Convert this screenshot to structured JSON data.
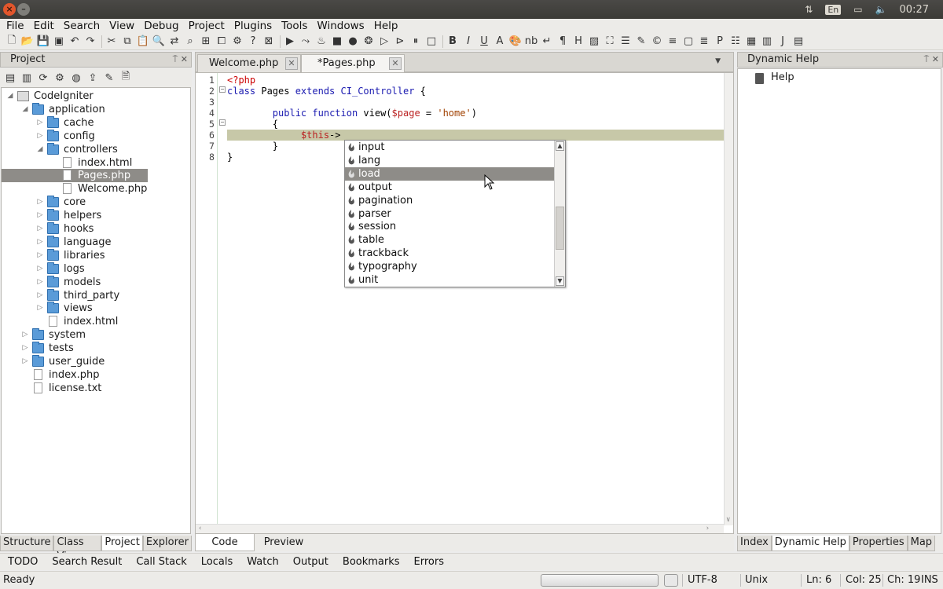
{
  "tray": {
    "language": "En",
    "clock": "00:27"
  },
  "menu": [
    "File",
    "Edit",
    "Search",
    "View",
    "Debug",
    "Project",
    "Plugins",
    "Tools",
    "Windows",
    "Help"
  ],
  "project_panel": {
    "title": "Project",
    "tree": [
      {
        "label": "CodeIgniter",
        "type": "root",
        "depth": 0,
        "arrow": "open"
      },
      {
        "label": "application",
        "type": "folder",
        "depth": 1,
        "arrow": "open"
      },
      {
        "label": "cache",
        "type": "folder",
        "depth": 2,
        "arrow": "closed"
      },
      {
        "label": "config",
        "type": "folder",
        "depth": 2,
        "arrow": "closed"
      },
      {
        "label": "controllers",
        "type": "folder",
        "depth": 2,
        "arrow": "open"
      },
      {
        "label": "index.html",
        "type": "file",
        "depth": 3,
        "arrow": "none"
      },
      {
        "label": "Pages.php",
        "type": "file",
        "depth": 3,
        "arrow": "none",
        "selected": true
      },
      {
        "label": "Welcome.php",
        "type": "file",
        "depth": 3,
        "arrow": "none"
      },
      {
        "label": "core",
        "type": "folder",
        "depth": 2,
        "arrow": "closed"
      },
      {
        "label": "helpers",
        "type": "folder",
        "depth": 2,
        "arrow": "closed"
      },
      {
        "label": "hooks",
        "type": "folder",
        "depth": 2,
        "arrow": "closed"
      },
      {
        "label": "language",
        "type": "folder",
        "depth": 2,
        "arrow": "closed"
      },
      {
        "label": "libraries",
        "type": "folder",
        "depth": 2,
        "arrow": "closed"
      },
      {
        "label": "logs",
        "type": "folder",
        "depth": 2,
        "arrow": "closed"
      },
      {
        "label": "models",
        "type": "folder",
        "depth": 2,
        "arrow": "closed"
      },
      {
        "label": "third_party",
        "type": "folder",
        "depth": 2,
        "arrow": "closed"
      },
      {
        "label": "views",
        "type": "folder",
        "depth": 2,
        "arrow": "closed"
      },
      {
        "label": "index.html",
        "type": "file",
        "depth": 2,
        "arrow": "none"
      },
      {
        "label": "system",
        "type": "folder",
        "depth": 1,
        "arrow": "closed"
      },
      {
        "label": "tests",
        "type": "folder",
        "depth": 1,
        "arrow": "closed"
      },
      {
        "label": "user_guide",
        "type": "folder",
        "depth": 1,
        "arrow": "closed"
      },
      {
        "label": "index.php",
        "type": "file",
        "depth": 1,
        "arrow": "none"
      },
      {
        "label": "license.txt",
        "type": "file",
        "depth": 1,
        "arrow": "none"
      }
    ],
    "tabs": [
      "Structure",
      "Class View",
      "Project",
      "Explorer"
    ],
    "active_tab": "Project"
  },
  "editor": {
    "tabs": [
      {
        "label": "Welcome.php",
        "active": false
      },
      {
        "label": "*Pages.php",
        "active": true
      }
    ],
    "line_numbers": [
      "1",
      "2",
      "3",
      "4",
      "5",
      "6",
      "7",
      "8"
    ],
    "code": [
      [
        {
          "t": "<?php",
          "c": "tag"
        }
      ],
      [
        {
          "t": "class",
          "c": "kw"
        },
        {
          "t": " Pages ",
          "c": ""
        },
        {
          "t": "extends",
          "c": "kw"
        },
        {
          "t": " ",
          "c": ""
        },
        {
          "t": "CI_Controller",
          "c": "cls"
        },
        {
          "t": " {",
          "c": ""
        }
      ],
      [],
      [
        {
          "t": "        ",
          "c": ""
        },
        {
          "t": "public",
          "c": "kw"
        },
        {
          "t": " ",
          "c": ""
        },
        {
          "t": "function",
          "c": "kw"
        },
        {
          "t": " view(",
          "c": ""
        },
        {
          "t": "$page",
          "c": "var"
        },
        {
          "t": " = ",
          "c": ""
        },
        {
          "t": "'home'",
          "c": "str"
        },
        {
          "t": ")",
          "c": ""
        }
      ],
      [
        {
          "t": "        {",
          "c": ""
        }
      ],
      [
        {
          "t": "             ",
          "c": ""
        },
        {
          "t": "$this",
          "c": "var"
        },
        {
          "t": "->",
          "c": ""
        }
      ],
      [
        {
          "t": "        }",
          "c": ""
        }
      ],
      [
        {
          "t": "}",
          "c": ""
        }
      ]
    ],
    "highlighted_line": 6,
    "bottom_tabs": [
      "Code",
      "Preview"
    ],
    "active_bottom_tab": "Code"
  },
  "autocomplete": {
    "items": [
      "input",
      "lang",
      "load",
      "output",
      "pagination",
      "parser",
      "session",
      "table",
      "trackback",
      "typography",
      "unit"
    ],
    "selected": "load"
  },
  "help_panel": {
    "title": "Dynamic Help",
    "item": "Help",
    "tabs": [
      "Index",
      "Dynamic Help",
      "Properties",
      "Map"
    ],
    "active_tab": "Dynamic Help"
  },
  "dock_tabs": [
    "TODO",
    "Search Result",
    "Call Stack",
    "Locals",
    "Watch",
    "Output",
    "Bookmarks",
    "Errors"
  ],
  "status": {
    "message": "Ready",
    "encoding": "UTF-8",
    "line_endings": "Unix",
    "line": "Ln: 6",
    "col": "Col: 25",
    "char": "Ch: 19",
    "mode": "INS"
  },
  "colors": {
    "selection": "#8e8c88",
    "current_line": "#c7c8a8",
    "folder": "#5a9bd8",
    "keyword": "#1a1ab0",
    "php_tag": "#cc0000"
  }
}
